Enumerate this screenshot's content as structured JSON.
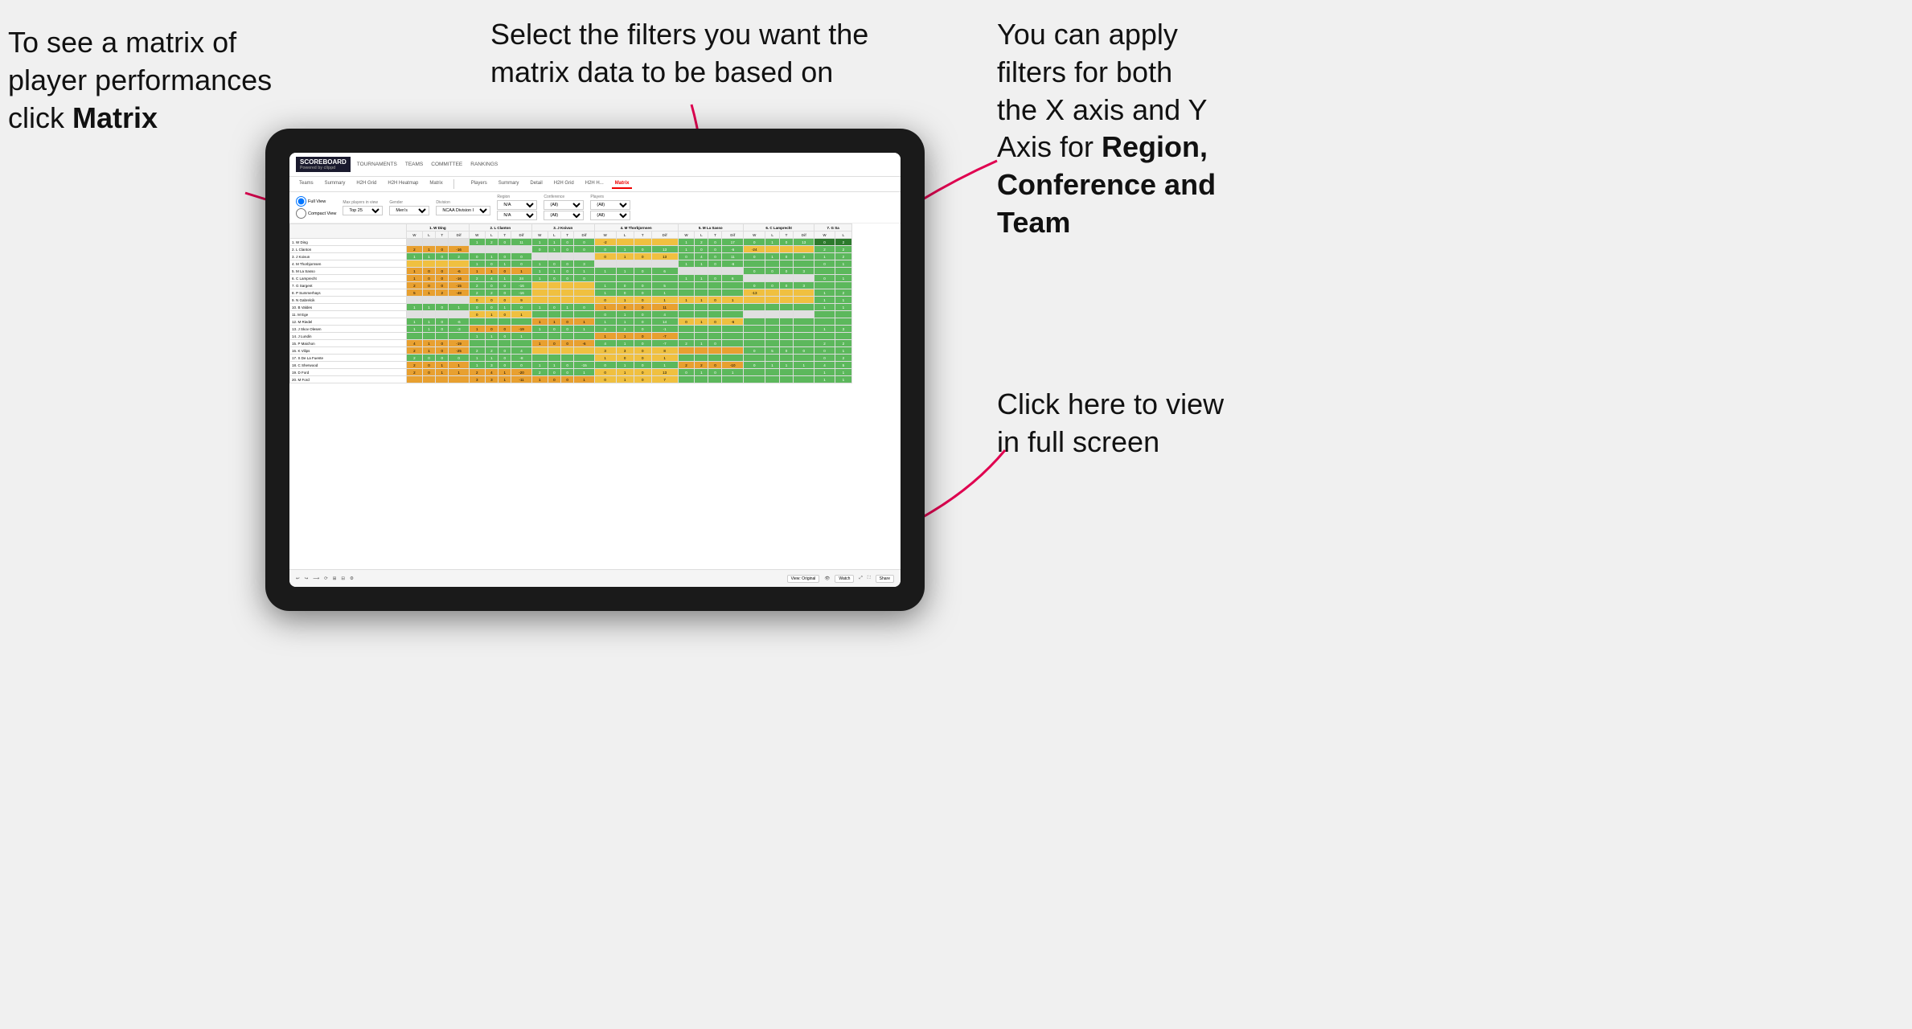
{
  "annotations": {
    "top_left": {
      "line1": "To see a matrix of",
      "line2": "player performances",
      "line3_normal": "click ",
      "line3_bold": "Matrix"
    },
    "top_center": {
      "text": "Select the filters you want the matrix data to be based on"
    },
    "top_right": {
      "line1": "You  can apply",
      "line2": "filters for both",
      "line3": "the X axis and Y",
      "line4_normal": "Axis for ",
      "line4_bold": "Region,",
      "line5_bold": "Conference and",
      "line6_bold": "Team"
    },
    "bottom_right": {
      "line1": "Click here to view",
      "line2": "in full screen"
    }
  },
  "scoreboard": {
    "logo": "SCOREBOARD",
    "logo_sub": "Powered by clippd",
    "nav": [
      "TOURNAMENTS",
      "TEAMS",
      "COMMITTEE",
      "RANKINGS"
    ],
    "sub_nav": [
      "Teams",
      "Summary",
      "H2H Grid",
      "H2H Heatmap",
      "Matrix",
      "Players",
      "Summary",
      "Detail",
      "H2H Grid",
      "H2H H...",
      "Matrix"
    ],
    "active_tab": "Matrix"
  },
  "filters": {
    "view_full": "Full View",
    "view_compact": "Compact View",
    "max_players_label": "Max players in view",
    "max_players_value": "Top 25",
    "gender_label": "Gender",
    "gender_value": "Men's",
    "division_label": "Division",
    "division_value": "NCAA Division I",
    "region_label": "Region",
    "region_value": "N/A",
    "conference_label": "Conference",
    "conference_value1": "(All)",
    "conference_value2": "(All)",
    "players_label": "Players",
    "players_value1": "(All)",
    "players_value2": "(All)"
  },
  "matrix": {
    "col_headers": [
      "1. W Ding",
      "2. L Clanton",
      "3. J Koivun",
      "4. M Thorbjornsen",
      "5. M La Sasso",
      "6. C Lamprecht",
      "7. G Sa"
    ],
    "sub_cols": [
      "W",
      "L",
      "T",
      "Dif"
    ],
    "players": [
      "1. W Ding",
      "2. L Clanton",
      "3. J Koivun",
      "4. M Thorbjornsen",
      "5. M La Sasso",
      "6. C Lamprecht",
      "7. G Sargent",
      "8. P Summerhays",
      "9. N Gabrelcik",
      "10. B Valdes",
      "11. M Ege",
      "12. M Riedel",
      "13. J Skov Olesen",
      "14. J Lundin",
      "15. P Maichon",
      "16. K Vilips",
      "17. S De La Fuente",
      "18. C Sherwood",
      "19. D Ford",
      "20. M Ford"
    ]
  },
  "toolbar": {
    "view_label": "View: Original",
    "watch_label": "Watch",
    "share_label": "Share"
  }
}
